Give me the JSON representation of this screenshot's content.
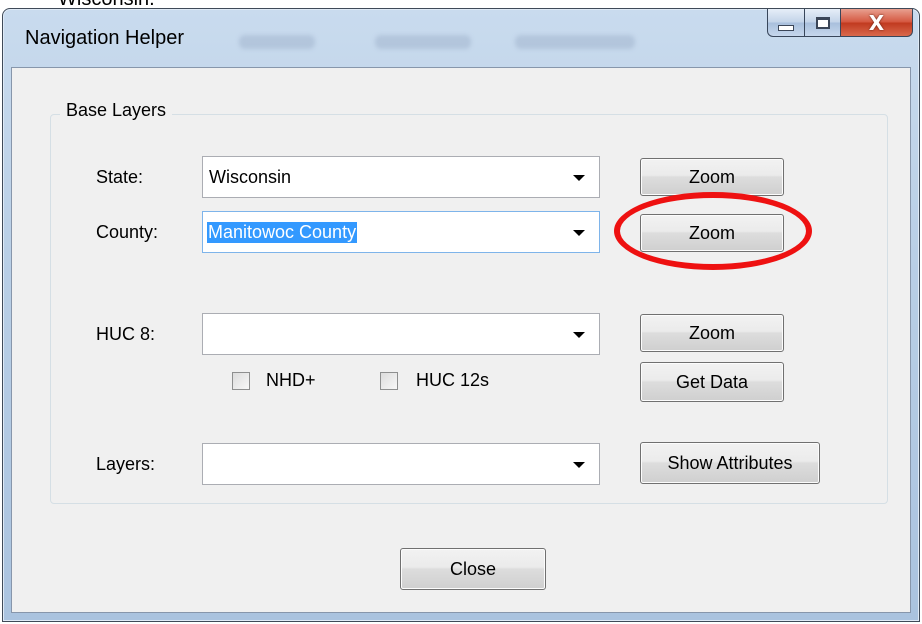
{
  "background_text": "Wisconsin.",
  "window": {
    "title": "Navigation Helper",
    "caption_buttons": {
      "minimize_icon": "minimize-icon",
      "maximize_icon": "maximize-icon",
      "close_icon": "close-icon",
      "close_glyph": "X"
    }
  },
  "group": {
    "title": "Base Layers"
  },
  "state": {
    "label": "State:",
    "value": "Wisconsin",
    "zoom_label": "Zoom"
  },
  "county": {
    "label": "County:",
    "value": "Manitowoc County",
    "zoom_label": "Zoom"
  },
  "huc8": {
    "label": "HUC 8:",
    "value": "",
    "zoom_label": "Zoom",
    "get_data_label": "Get Data",
    "nhd_label": "NHD+",
    "nhd_checked": false,
    "huc12_label": "HUC 12s",
    "huc12_checked": false
  },
  "layers": {
    "label": "Layers:",
    "value": "",
    "show_attributes_label": "Show Attributes"
  },
  "footer": {
    "close_label": "Close"
  },
  "colors": {
    "highlight_ring": "#ee1111",
    "selection": "#3399ff"
  }
}
